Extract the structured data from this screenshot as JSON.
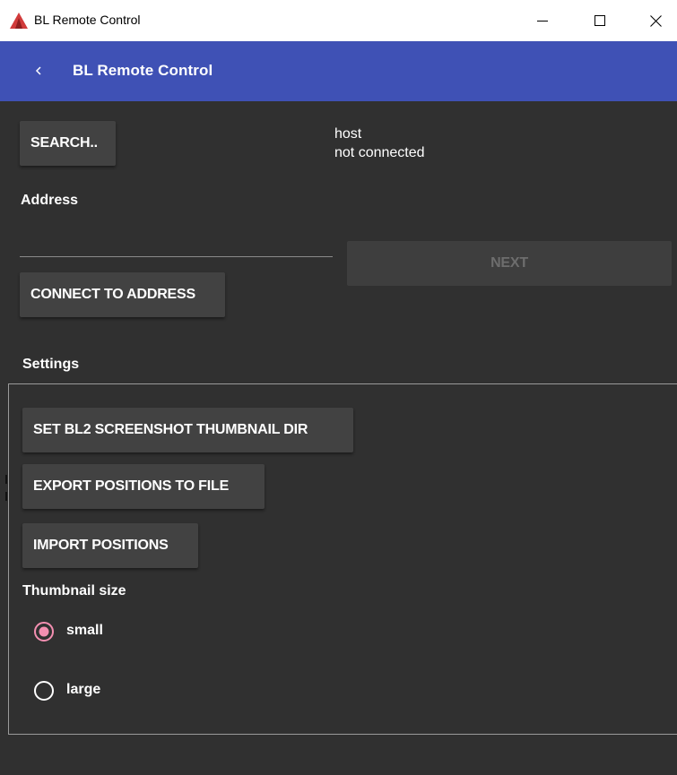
{
  "window": {
    "title": "BL Remote Control",
    "logo_icon": "app-logo-icon",
    "controls": [
      "minimize-icon",
      "maximize-icon",
      "close-icon"
    ]
  },
  "appbar": {
    "title": "BL Remote Control",
    "back_icon": "chevron-left-icon",
    "color": "#3f51b5"
  },
  "connection": {
    "search_label": "SEARCH..",
    "host_label": "host",
    "status": "not connected",
    "address_label": "Address",
    "address_value": "",
    "next_label": "NEXT",
    "connect_label": "CONNECT TO ADDRESS"
  },
  "settings": {
    "title": "Settings",
    "thumbnail_dir_label": "SET BL2 SCREENSHOT THUMBNAIL DIR",
    "export_label": "EXPORT POSITIONS TO FILE",
    "import_label": "IMPORT POSITIONS",
    "thumbnail_size_label": "Thumbnail size",
    "thumbnail_options": [
      {
        "label": "small",
        "selected": true
      },
      {
        "label": "large",
        "selected": false
      }
    ],
    "radio_accent": "#f48fb1"
  }
}
